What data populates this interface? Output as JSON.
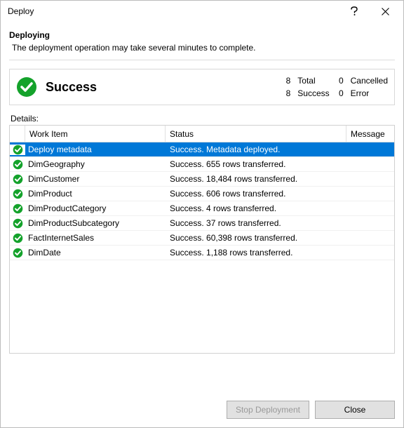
{
  "window": {
    "title": "Deploy"
  },
  "header": {
    "heading": "Deploying",
    "subtext": "The deployment operation may take several minutes to complete."
  },
  "banner": {
    "title": "Success",
    "stats": {
      "total_n": "8",
      "total_label": "Total",
      "cancelled_n": "0",
      "cancelled_label": "Cancelled",
      "success_n": "8",
      "success_label": "Success",
      "error_n": "0",
      "error_label": "Error"
    }
  },
  "details_label": "Details:",
  "columns": {
    "work": "Work Item",
    "status": "Status",
    "message": "Message"
  },
  "rows": [
    {
      "work": "Deploy metadata",
      "status": "Success. Metadata deployed.",
      "message": "",
      "selected": true
    },
    {
      "work": "DimGeography",
      "status": "Success. 655 rows transferred.",
      "message": "",
      "selected": false
    },
    {
      "work": "DimCustomer",
      "status": "Success. 18,484 rows transferred.",
      "message": "",
      "selected": false
    },
    {
      "work": "DimProduct",
      "status": "Success. 606 rows transferred.",
      "message": "",
      "selected": false
    },
    {
      "work": "DimProductCategory",
      "status": "Success. 4 rows transferred.",
      "message": "",
      "selected": false
    },
    {
      "work": "DimProductSubcategory",
      "status": "Success. 37 rows transferred.",
      "message": "",
      "selected": false
    },
    {
      "work": "FactInternetSales",
      "status": "Success. 60,398 rows transferred.",
      "message": "",
      "selected": false
    },
    {
      "work": "DimDate",
      "status": "Success. 1,188 rows transferred.",
      "message": "",
      "selected": false
    }
  ],
  "buttons": {
    "stop": "Stop Deployment",
    "close": "Close"
  }
}
